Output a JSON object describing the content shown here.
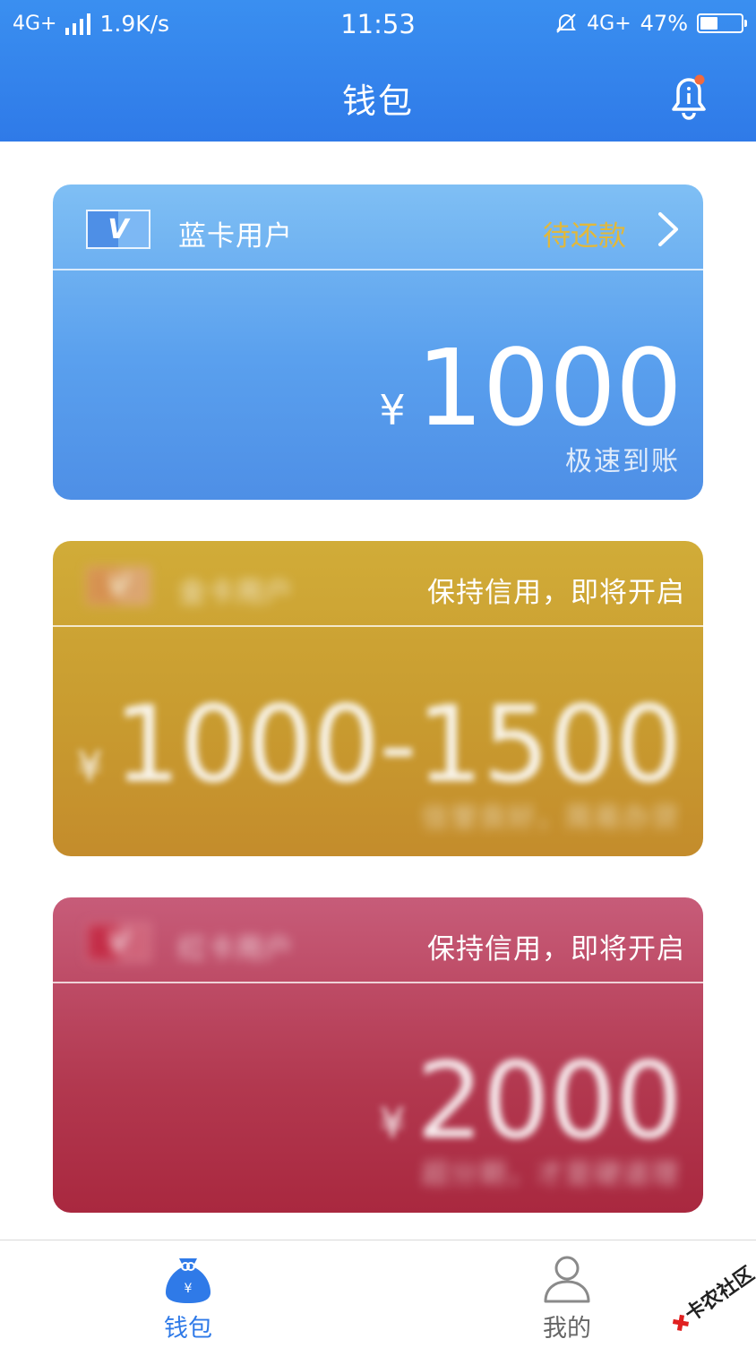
{
  "status_bar": {
    "network": "4G+",
    "speed": "1.9K/s",
    "time": "11:53",
    "right_network": "4G+",
    "battery_percent": "47%",
    "battery_level": 0.47
  },
  "header": {
    "title": "钱包"
  },
  "cards": {
    "blue": {
      "badge_letter": "V",
      "name": "蓝卡用户",
      "status": "待还款",
      "currency": "¥",
      "amount": "1000",
      "note": "极速到账"
    },
    "gold": {
      "badge_letter": "V",
      "name": "金卡用户",
      "hint": "保持信用，即将开启",
      "currency": "¥",
      "amount": "1000-1500",
      "note": "信誉良好，简易办贷"
    },
    "red": {
      "badge_letter": "V",
      "name": "红卡用户",
      "hint": "保持信用，即将开启",
      "currency": "¥",
      "amount": "2000",
      "note": "超分期，才是硬道理"
    }
  },
  "bottom_nav": {
    "wallet_label": "钱包",
    "mine_label": "我的"
  },
  "watermark": {
    "text": "卡农社区"
  },
  "colors": {
    "header_blue": "#2f7ae8",
    "status_gold": "#e2b83a",
    "nav_active": "#2f7ae8"
  },
  "icons": [
    "signal-icon",
    "alarm-off-icon",
    "battery-icon",
    "bell-icon",
    "chevron-right-icon",
    "money-bag-icon",
    "user-icon"
  ]
}
